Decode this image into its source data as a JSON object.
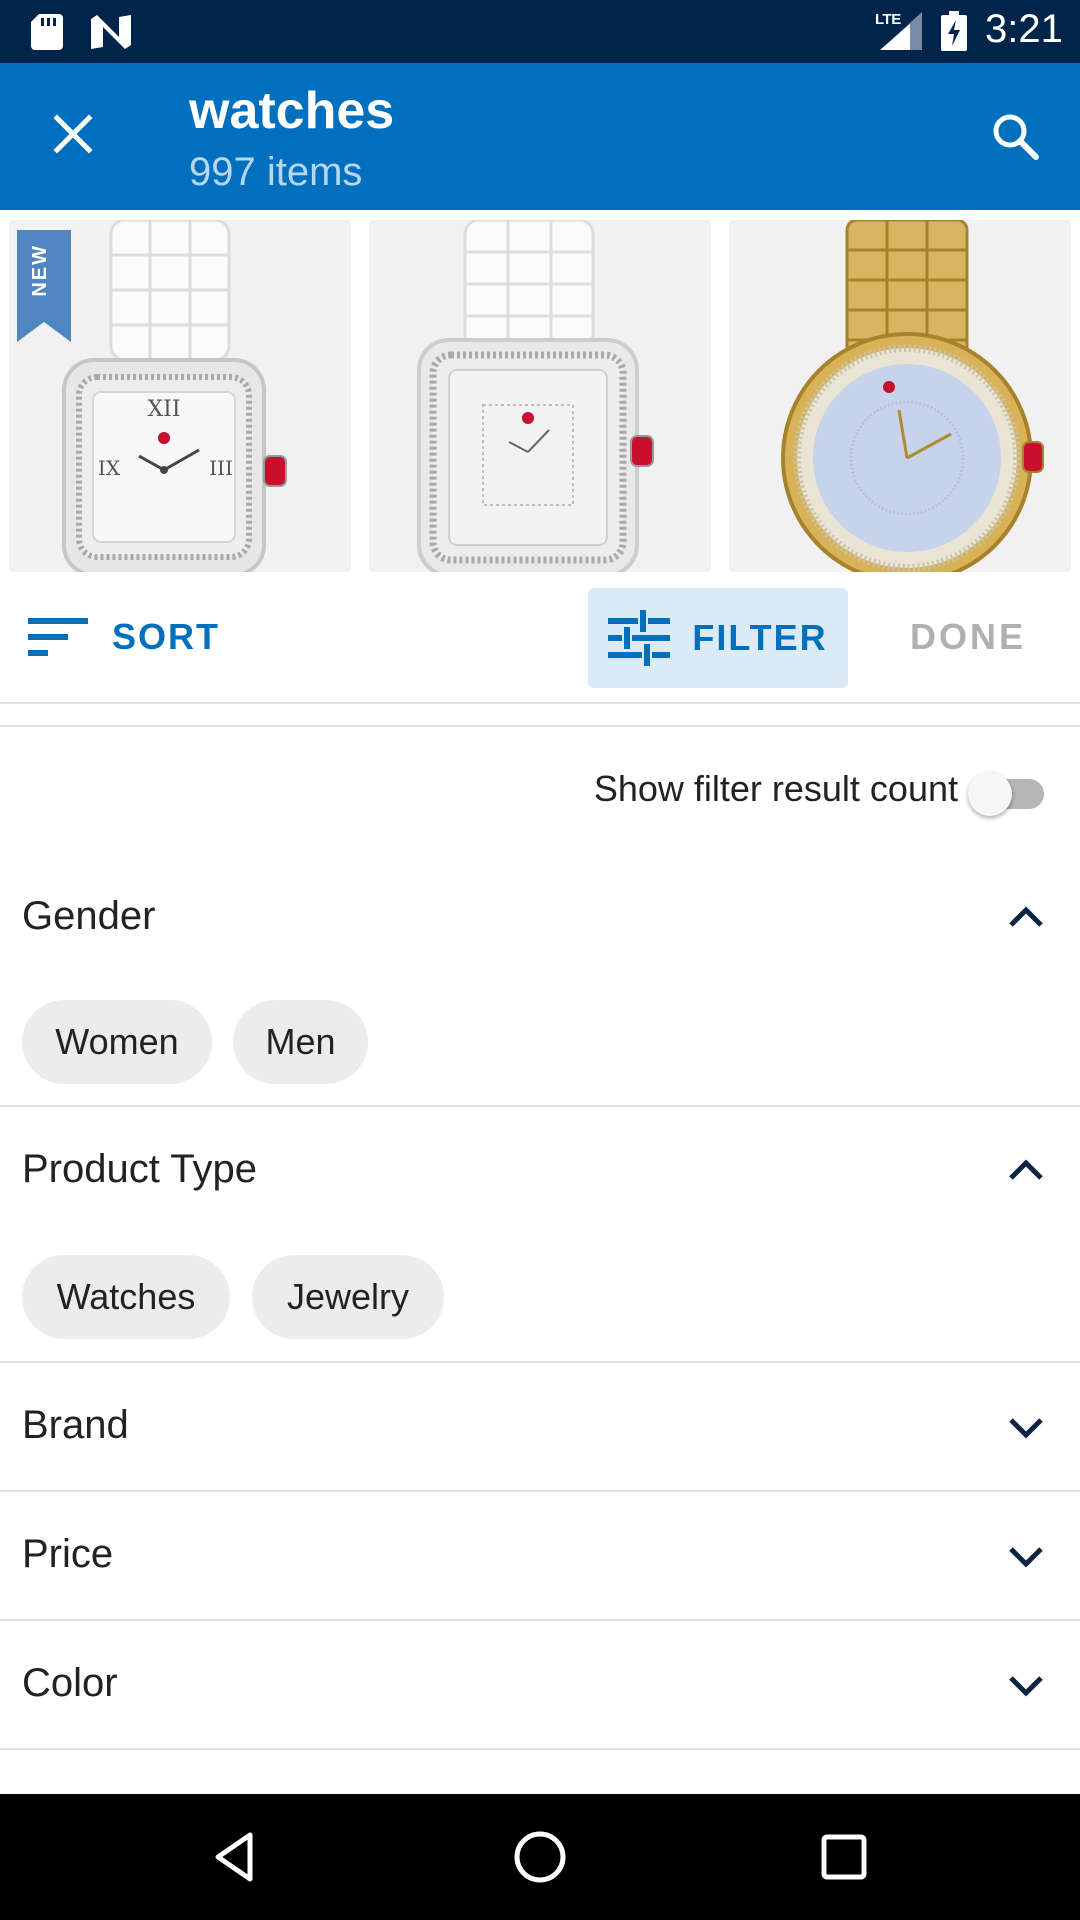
{
  "status_bar": {
    "network": "LTE",
    "time": "3:21",
    "icons": [
      "sd-card-icon",
      "n-icon",
      "signal-icon",
      "battery-charging-icon"
    ]
  },
  "app_bar": {
    "title": "watches",
    "subtitle": "997 items",
    "close_icon": "close-icon",
    "search_icon": "search-icon",
    "background": "#0070be"
  },
  "products": [
    {
      "badge": "NEW",
      "kind": "white-ceramic-square-watch"
    },
    {
      "kind": "white-ceramic-square-watch"
    },
    {
      "kind": "gold-round-watch"
    }
  ],
  "toolbar": {
    "sort_label": "SORT",
    "filter_label": "FILTER",
    "done_label": "DONE",
    "accent": "#0070be"
  },
  "filter_panel": {
    "toggle_label": "Show filter result count",
    "toggle_on": false,
    "sections": [
      {
        "title": "Gender",
        "expanded": true,
        "chips": [
          "Women",
          "Men"
        ]
      },
      {
        "title": "Product Type",
        "expanded": true,
        "chips": [
          "Watches",
          "Jewelry"
        ]
      },
      {
        "title": "Brand",
        "expanded": false
      },
      {
        "title": "Price",
        "expanded": false
      },
      {
        "title": "Color",
        "expanded": false
      }
    ]
  },
  "nav_bar": {
    "icons": [
      "back-icon",
      "home-icon",
      "recents-icon"
    ]
  }
}
